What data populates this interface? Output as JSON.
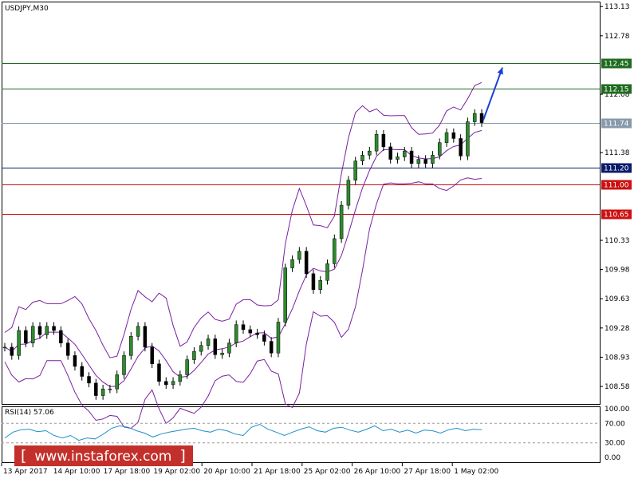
{
  "chart_data": {
    "type": "candlestick",
    "title": "USDJPY,M30",
    "price_axis": {
      "ticks": [
        "113.13",
        "112.78",
        "112.08",
        "111.38",
        "110.33",
        "109.98",
        "109.63",
        "109.28",
        "108.93",
        "108.58"
      ],
      "range": [
        108.37,
        113.18
      ]
    },
    "levels": [
      {
        "value": 112.45,
        "label": "112.45",
        "color": "#1f6b1f",
        "label_bg": "#1f6b1f"
      },
      {
        "value": 112.15,
        "label": "112.15",
        "color": "#1f6b1f",
        "label_bg": "#1f6b1f"
      },
      {
        "value": 111.74,
        "label": "111.74",
        "color": "#8899aa",
        "label_bg": "#8899aa"
      },
      {
        "value": 111.2,
        "label": "111.20",
        "color": "#0b1c6b",
        "label_bg": "#0b1c6b"
      },
      {
        "value": 111.0,
        "label": "111.00",
        "color": "#cc1111",
        "label_bg": "#cc1111"
      },
      {
        "value": 110.65,
        "label": "110.65",
        "color": "#cc1111",
        "label_bg": "#cc1111"
      }
    ],
    "price_series": [
      109.05,
      108.95,
      109.25,
      109.1,
      109.3,
      109.2,
      109.3,
      109.25,
      109.1,
      108.95,
      108.82,
      108.7,
      108.62,
      108.47,
      108.55,
      108.55,
      108.72,
      108.95,
      109.18,
      109.3,
      109.05,
      108.85,
      108.64,
      108.6,
      108.64,
      108.72,
      108.9,
      109.0,
      109.07,
      109.15,
      108.96,
      108.98,
      109.1,
      109.32,
      109.26,
      109.22,
      109.2,
      109.12,
      108.98,
      109.35,
      110.0,
      110.1,
      110.2,
      109.93,
      109.74,
      109.85,
      110.05,
      110.35,
      110.75,
      111.05,
      111.28,
      111.35,
      111.4,
      111.6,
      111.45,
      111.3,
      111.33,
      111.4,
      111.25,
      111.3,
      111.25,
      111.35,
      111.5,
      111.62,
      111.55,
      111.34,
      111.75,
      111.85,
      111.74
    ],
    "time_labels": [
      "13 Apr 2017",
      "14 Apr 10:00",
      "17 Apr 18:00",
      "19 Apr 02:00",
      "20 Apr 10:00",
      "21 Apr 18:00",
      "25 Apr 02:00",
      "26 Apr 10:00",
      "27 Apr 18:00",
      "1 May 02:00"
    ],
    "forecast_arrow": {
      "from": 111.77,
      "to": 112.4
    },
    "rsi": {
      "label": "RSI(14) 57.06",
      "value": 57.06,
      "levels": [
        30,
        70
      ],
      "ticks": [
        "100.00",
        "70.00",
        "30.00",
        "0.00"
      ],
      "series": [
        40,
        52,
        57,
        58,
        53,
        55,
        45,
        40,
        45,
        35,
        40,
        38,
        48,
        60,
        65,
        62,
        55,
        50,
        42,
        48,
        52,
        55,
        58,
        60,
        55,
        52,
        58,
        55,
        48,
        45,
        62,
        68,
        58,
        52,
        45,
        52,
        58,
        63,
        55,
        52,
        60,
        62,
        56,
        52,
        58,
        65,
        55,
        58,
        52,
        56,
        50,
        56,
        55,
        50,
        57,
        60,
        55,
        58,
        57
      ]
    }
  },
  "watermark": {
    "bracket_open": "[",
    "text": "www.instaforex.com",
    "bracket_close": "]"
  }
}
